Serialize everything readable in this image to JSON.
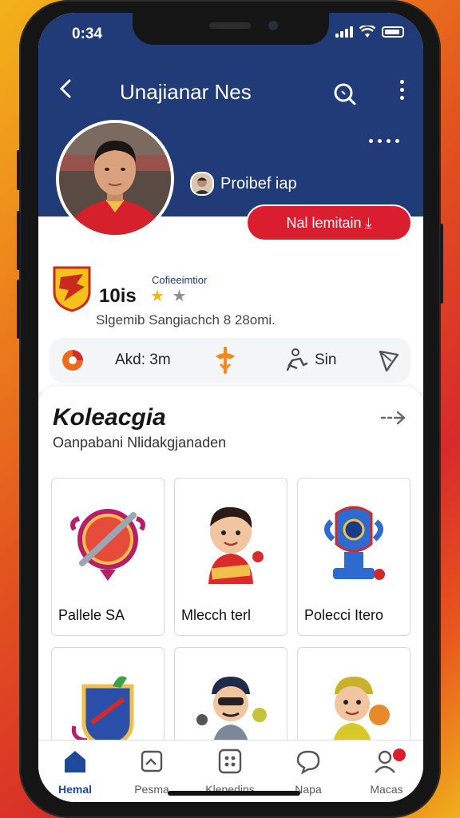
{
  "status_bar": {
    "time": "0:34"
  },
  "header": {
    "title": "Unajianar Nes"
  },
  "profile": {
    "verified_label": "Proibef iap",
    "follow_button": "Nal lemitain ⤓",
    "small_label": "Cofieeimtior",
    "name": "10is",
    "stars": [
      "★",
      "★"
    ],
    "description": "Slgemib Sangiachch 8 28omi."
  },
  "stats": [
    {
      "icon": "flame-icon",
      "label": "Akd: 3m"
    },
    {
      "icon": "whistle-icon",
      "label": ""
    },
    {
      "icon": "figure-icon",
      "label": "Sin"
    },
    {
      "icon": "share-icon",
      "label": ""
    }
  ],
  "collection": {
    "title": "Koleacgia",
    "subtitle": "Oanpabani Nlidakgjanaden",
    "items": [
      {
        "name": "Pallele SA"
      },
      {
        "name": "Mlecch terl"
      },
      {
        "name": "Polecci Itero"
      },
      {
        "name": ""
      },
      {
        "name": ""
      },
      {
        "name": ""
      }
    ]
  },
  "nav": [
    {
      "label": "Hemal"
    },
    {
      "label": "Pesma"
    },
    {
      "label": "Klenedins"
    },
    {
      "label": "Napa"
    },
    {
      "label": "Macas"
    }
  ],
  "colors": {
    "header": "#213a78",
    "accent_red": "#da1e2f",
    "active_nav": "#1f4a9c"
  }
}
